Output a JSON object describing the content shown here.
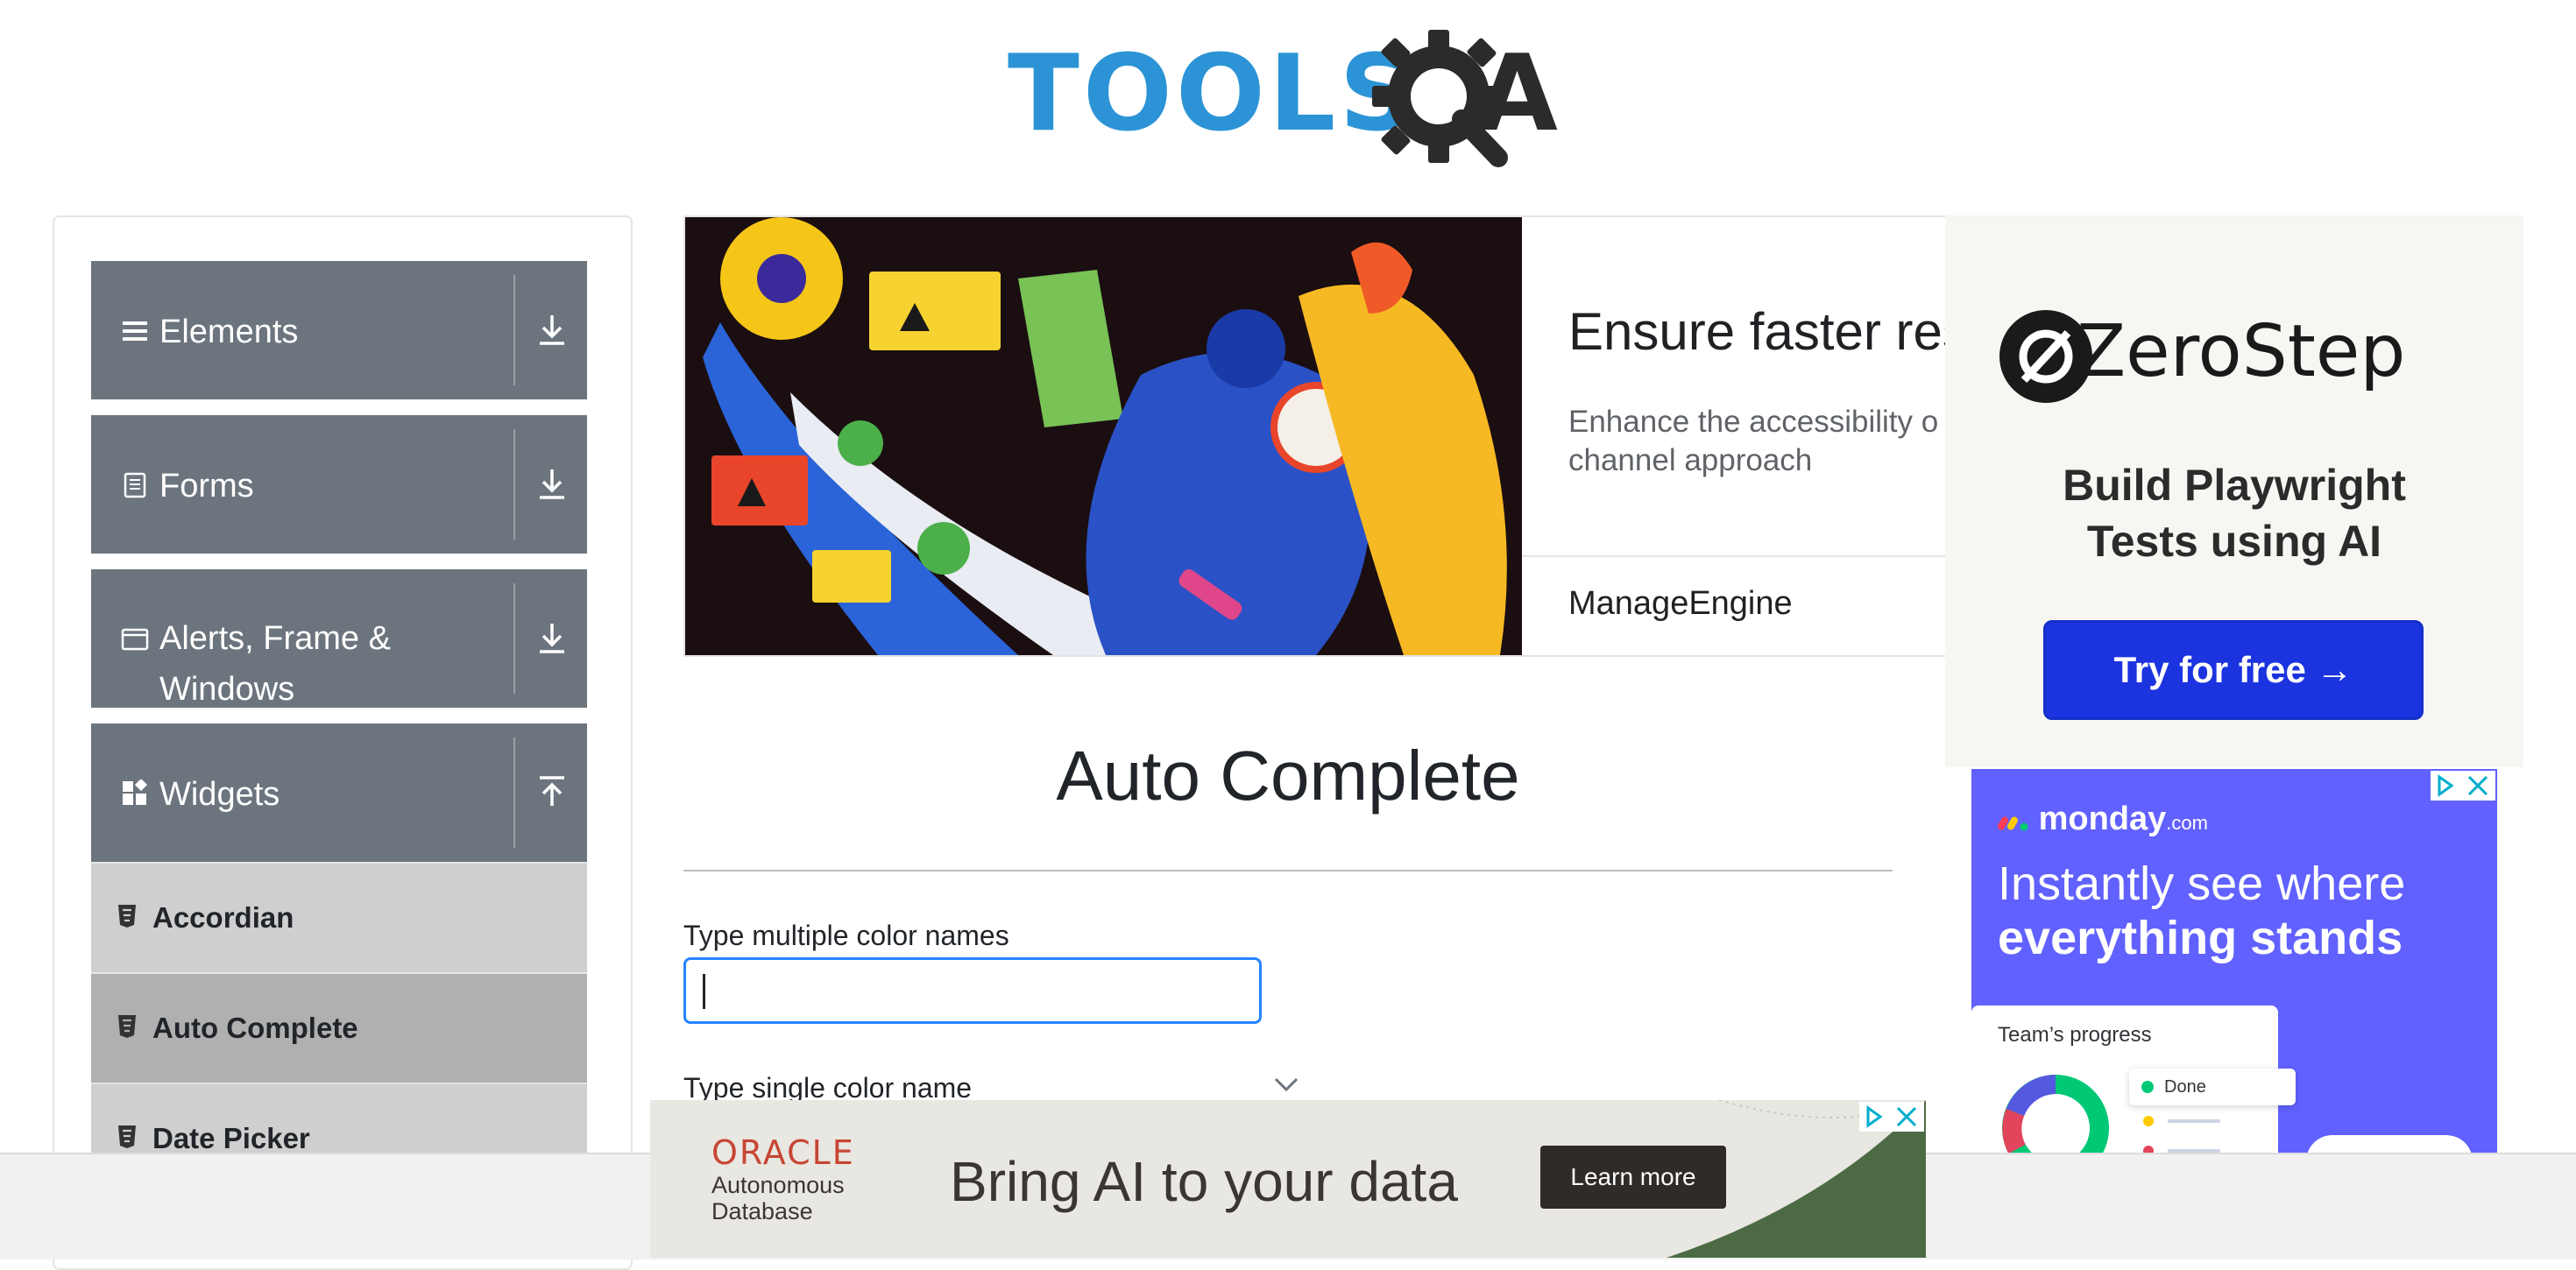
{
  "header": {
    "logo_text_tools": "TOOLS",
    "logo_text_a": "A"
  },
  "sidebar": {
    "groups": [
      {
        "label": "Elements",
        "arrow": "down"
      },
      {
        "label": "Forms",
        "arrow": "down"
      },
      {
        "label": "Alerts, Frame & Windows",
        "arrow": "down"
      },
      {
        "label": "Widgets",
        "arrow": "up"
      }
    ],
    "items": [
      {
        "label": "Accordian",
        "active": false
      },
      {
        "label": "Auto Complete",
        "active": true
      },
      {
        "label": "Date Picker",
        "active": false
      }
    ]
  },
  "banner_ad": {
    "title": "Ensure faster res",
    "description": "Enhance the accessibility o our omni-channel approach",
    "brand": "ManageEngine"
  },
  "main": {
    "page_title": "Auto Complete",
    "multi_label": "Type multiple color names",
    "multi_value": "",
    "single_label": "Type single color name"
  },
  "zerostep_ad": {
    "brand": "ZeroStep",
    "headline_line1": "Build Playwright",
    "headline_line2": "Tests using AI",
    "cta": "Try for free →"
  },
  "monday_ad": {
    "logo": "monday",
    "logo_suffix": ".com",
    "headline_line1": "Instantly see where",
    "headline_line2": "everything stands",
    "card_title": "Team’s progress",
    "status_done": "Done"
  },
  "oracle_ad": {
    "logo": "ORACLE",
    "sub_line1": "Autonomous",
    "sub_line2": "Database",
    "headline": "Bring AI to your data",
    "cta": "Learn more"
  },
  "colors": {
    "accent_blue": "#2684ff",
    "sidebar_group": "#6c757d",
    "sidebar_item": "#cfcfcf",
    "sidebar_item_active": "#b0b0b0",
    "monday_purple": "#6161ff",
    "zerostep_cta": "#1c33e0",
    "oracle_red": "#c74634"
  }
}
